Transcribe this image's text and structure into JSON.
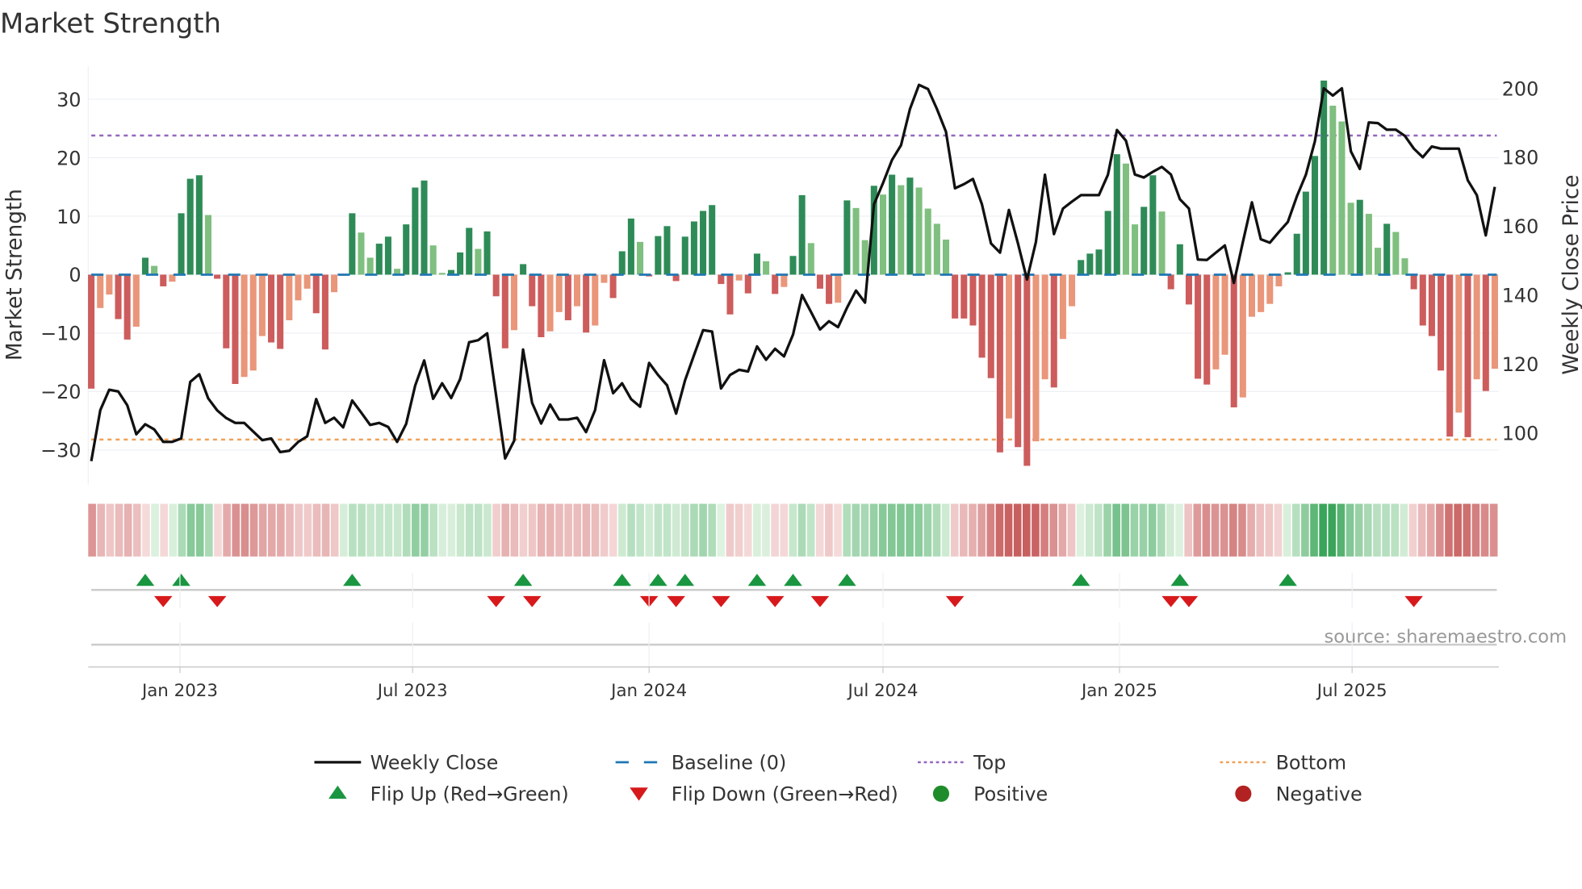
{
  "title": "Market Strength",
  "source": "source: sharemaestro.com",
  "colors": {
    "close": "#111111",
    "baseline": "#1f77b4",
    "top": "#9467bd",
    "bottom": "#f0a15a",
    "green_dark": "#2e8b57",
    "green_light": "#7fbf7f",
    "red_dark": "#cd5c5c",
    "red_light": "#e9967a",
    "flip_up": "#1a9641",
    "flip_down": "#d7191c",
    "positive": "#1e8c2a",
    "negative": "#b22222"
  },
  "chart_data": {
    "type": "bar+line",
    "title": "Market Strength",
    "ylabel": "Market Strength",
    "y2label": "Weekly Close Price",
    "ylim": [
      -35.9,
      35.7
    ],
    "y2lim": [
      85,
      206.5
    ],
    "yticks": [
      30,
      20,
      10,
      0,
      -10,
      -20,
      -30
    ],
    "y2ticks": [
      200,
      180,
      160,
      140,
      120,
      100
    ],
    "ytick_labels": [
      "30",
      "20",
      "10",
      "0",
      "−10",
      "−20",
      "−30"
    ],
    "y2tick_labels": [
      "200",
      "180",
      "160",
      "140",
      "120",
      "100"
    ],
    "start_date": "2022-10-24",
    "frequency": "weekly",
    "xticks": [
      {
        "date": "2023-01-01",
        "label": "Jan 2023"
      },
      {
        "date": "2023-07-01",
        "label": "Jul 2023"
      },
      {
        "date": "2024-01-01",
        "label": "Jan 2024"
      },
      {
        "date": "2024-07-01",
        "label": "Jul 2024"
      },
      {
        "date": "2025-01-01",
        "label": "Jan 2025"
      },
      {
        "date": "2025-07-01",
        "label": "Jul 2025"
      }
    ],
    "top_level": 23.8,
    "bottom_level": -28.2,
    "baseline": 0,
    "strength": [
      -19.5,
      -5.7,
      -3.4,
      -7.6,
      -11.1,
      -8.9,
      2.9,
      1.5,
      -2.0,
      -1.2,
      10.5,
      16.4,
      17.0,
      10.2,
      -0.7,
      -12.6,
      -18.7,
      -17.5,
      -16.4,
      -10.5,
      -11.6,
      -12.7,
      -7.8,
      -4.4,
      -2.4,
      -6.6,
      -12.8,
      -3.0,
      -0.2,
      10.5,
      7.2,
      2.9,
      5.3,
      6.5,
      1.0,
      8.6,
      14.9,
      16.1,
      5.0,
      0.3,
      0.8,
      3.8,
      8.0,
      4.4,
      7.4,
      -3.7,
      -12.6,
      -9.5,
      1.8,
      -5.4,
      -10.7,
      -9.7,
      -6.4,
      -7.8,
      -5.4,
      -9.9,
      -8.7,
      -1.4,
      -4.0,
      4.0,
      9.6,
      5.6,
      -0.3,
      6.6,
      8.3,
      -1.1,
      6.5,
      9.1,
      10.9,
      11.9,
      -1.6,
      -6.8,
      -1.0,
      -3.2,
      3.6,
      2.3,
      -3.3,
      -2.1,
      3.2,
      13.6,
      5.4,
      -2.4,
      -5.0,
      -4.8,
      12.7,
      11.4,
      5.9,
      15.2,
      13.7,
      17.1,
      15.3,
      16.6,
      14.9,
      11.3,
      8.7,
      6.0,
      -7.5,
      -7.5,
      -8.7,
      -14.2,
      -17.7,
      -30.4,
      -24.6,
      -29.5,
      -32.7,
      -28.5,
      -17.9,
      -19.3,
      -11.0,
      -5.4,
      2.5,
      3.6,
      4.3,
      10.9,
      20.6,
      19.0,
      8.6,
      11.6,
      17.0,
      10.8,
      -2.5,
      5.2,
      -5.1,
      -17.8,
      -18.8,
      -16.2,
      -13.7,
      -22.7,
      -21.0,
      -7.2,
      -6.4,
      -5.0,
      -2.0,
      0.4,
      7.0,
      14.2,
      20.3,
      33.2,
      28.9,
      26.2,
      12.3,
      12.8,
      10.4,
      4.6,
      8.7,
      7.3,
      2.8,
      -2.5,
      -8.7,
      -10.5,
      -16.4,
      -27.7,
      -23.6,
      -27.8,
      -17.9,
      -19.9,
      -16.1
    ],
    "close": [
      91.8,
      106.6,
      112.5,
      112,
      108,
      99.6,
      102.5,
      101,
      97.4,
      97.4,
      98.4,
      114.8,
      117,
      110,
      106.5,
      104.3,
      102.9,
      102.9,
      100.4,
      97.9,
      98.4,
      94.4,
      94.8,
      97.4,
      99,
      109.8,
      102.9,
      104.4,
      101.6,
      109.4,
      105.9,
      102.3,
      102.9,
      101.7,
      97.4,
      102.6,
      113.7,
      121,
      109.9,
      114.4,
      110.1,
      115.6,
      126.3,
      126.9,
      128.9,
      110.9,
      92.6,
      97.7,
      124.2,
      108.7,
      102.7,
      108.2,
      103.9,
      103.9,
      104.4,
      100.2,
      106.6,
      121.1,
      111.5,
      114.4,
      109.8,
      107.6,
      120.3,
      116.8,
      113.8,
      105.6,
      115.2,
      122.6,
      129.8,
      129.4,
      112.9,
      116.8,
      118.3,
      117.8,
      125.1,
      121.2,
      124.4,
      122.2,
      128.5,
      140,
      135.1,
      130,
      132.4,
      130.7,
      136.3,
      141.3,
      137.8,
      166.3,
      172.5,
      179.2,
      183.5,
      194,
      201,
      199.8,
      194,
      187.4,
      171,
      172.2,
      173.7,
      166.3,
      155,
      152.3,
      164.7,
      155,
      144.5,
      155.4,
      174.9,
      157.7,
      165.1,
      167.1,
      169,
      169,
      169,
      174.9,
      187.9,
      184.8,
      175,
      174.1,
      175.8,
      177.2,
      175,
      167.8,
      165.1,
      150.3,
      150.2,
      152.3,
      154.4,
      143.5,
      155.4,
      166.9,
      156.2,
      155.2,
      158.3,
      161.2,
      168.6,
      174.9,
      184.6,
      200,
      197.9,
      200,
      181.7,
      176.6,
      190.1,
      189.9,
      188,
      188,
      186.2,
      182.5,
      180,
      183.1,
      182.5,
      182.5,
      182.5,
      173.3,
      169,
      157.3,
      171.4
    ],
    "flip_up_weeks": [
      7,
      11,
      30,
      49,
      60,
      64,
      67,
      75,
      79,
      85,
      111,
      122,
      134
    ],
    "flip_down_weeks": [
      9,
      15,
      46,
      50,
      63,
      66,
      71,
      77,
      82,
      97,
      121,
      123,
      148
    ],
    "legend_position": "bottom",
    "legend": [
      {
        "label": "Weekly Close",
        "symbol": "line"
      },
      {
        "label": "Baseline (0)",
        "symbol": "dash"
      },
      {
        "label": "Top",
        "symbol": "dot"
      },
      {
        "label": "Bottom",
        "symbol": "dot"
      },
      {
        "label": "Flip Up (Red→Green)",
        "symbol": "triangle-up"
      },
      {
        "label": "Flip Down (Green→Red)",
        "symbol": "triangle-down"
      },
      {
        "label": "Positive",
        "symbol": "circle"
      },
      {
        "label": "Negative",
        "symbol": "circle"
      }
    ]
  }
}
